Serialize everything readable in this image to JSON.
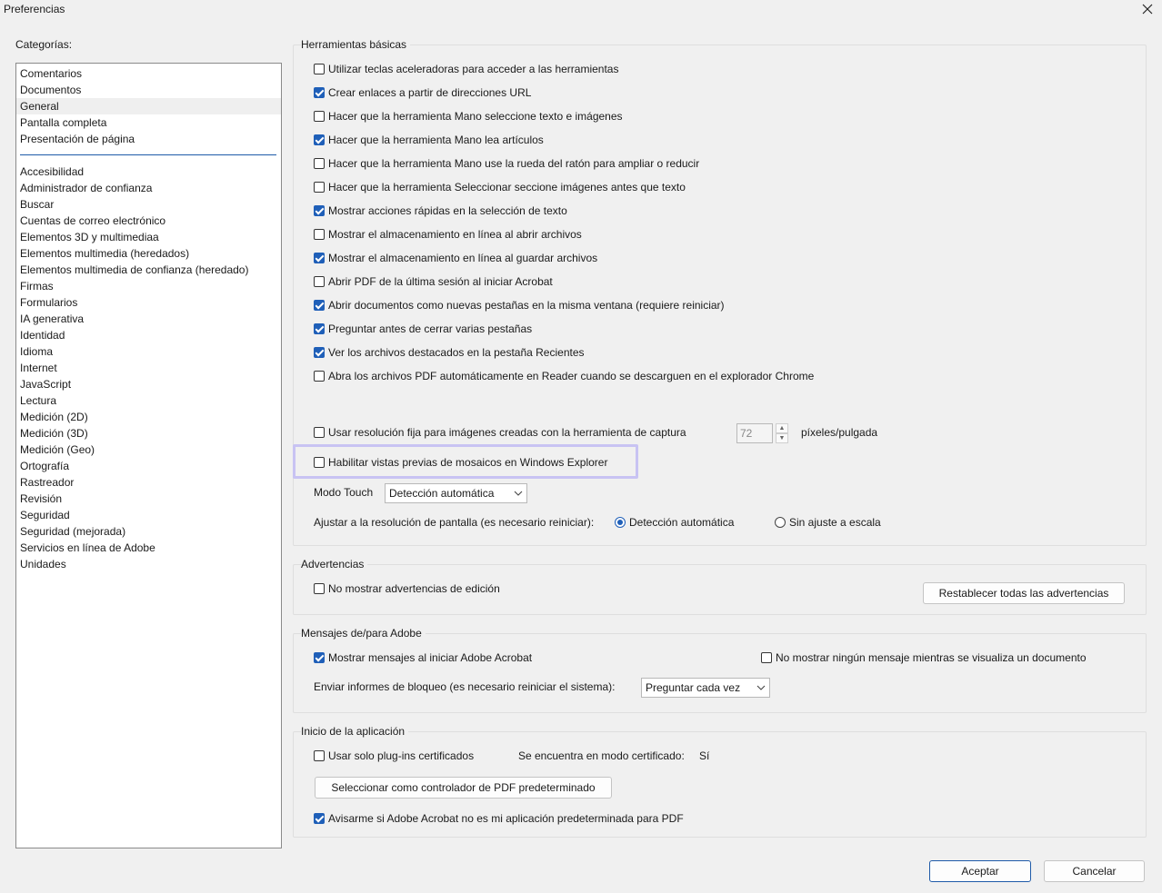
{
  "window": {
    "title": "Preferencias"
  },
  "categories": {
    "label": "Categorías:",
    "top_items": [
      "Comentarios",
      "Documentos",
      "General",
      "Pantalla completa",
      "Presentación de página"
    ],
    "items": [
      "Accesibilidad",
      "Administrador de confianza",
      "Buscar",
      "Cuentas de correo electrónico",
      "Elementos 3D y multimediaa",
      "Elementos multimedia (heredados)",
      "Elementos multimedia de confianza (heredado)",
      "Firmas",
      "Formularios",
      "IA generativa",
      "Identidad",
      "Idioma",
      "Internet",
      "JavaScript",
      "Lectura",
      "Medición (2D)",
      "Medición (3D)",
      "Medición (Geo)",
      "Ortografía",
      "Rastreador",
      "Revisión",
      "Seguridad",
      "Seguridad (mejorada)",
      "Servicios en línea de Adobe",
      "Unidades"
    ],
    "selected": "General"
  },
  "basic_tools": {
    "title": "Herramientas básicas",
    "options": [
      {
        "label": "Utilizar teclas aceleradoras para acceder a las herramientas",
        "checked": false
      },
      {
        "label": "Crear enlaces a partir de direcciones URL",
        "checked": true
      },
      {
        "label": "Hacer que la herramienta Mano seleccione texto e imágenes",
        "checked": false
      },
      {
        "label": "Hacer que la herramienta Mano lea artículos",
        "checked": true
      },
      {
        "label": "Hacer que la herramienta Mano use la rueda del ratón para ampliar o reducir",
        "checked": false
      },
      {
        "label": "Hacer que la herramienta Seleccionar seccione imágenes antes que texto",
        "checked": false
      },
      {
        "label": "Mostrar acciones rápidas en la selección de texto",
        "checked": true
      },
      {
        "label": "Mostrar el almacenamiento en línea al abrir archivos",
        "checked": false
      },
      {
        "label": "Mostrar el almacenamiento en línea al guardar archivos",
        "checked": true
      },
      {
        "label": "Abrir PDF de la última sesión al iniciar Acrobat",
        "checked": false
      },
      {
        "label": "Abrir documentos como nuevas pestañas en la misma ventana (requiere reiniciar)",
        "checked": true
      },
      {
        "label": "Preguntar antes de cerrar varias pestañas",
        "checked": true
      },
      {
        "label": "Ver los archivos destacados en la pestaña Recientes",
        "checked": true
      },
      {
        "label": "Abra los archivos PDF automáticamente en Reader cuando se descarguen en el explorador Chrome",
        "checked": false
      }
    ],
    "fixed_resolution": {
      "label": "Usar resolución fija para imágenes creadas con la herramienta de captura",
      "checked": false,
      "value": "72",
      "unit": "píxeles/pulgada"
    },
    "thumbnails": {
      "label": "Habilitar vistas previas de mosaicos en Windows Explorer",
      "checked": false
    },
    "touch_mode": {
      "label": "Modo Touch",
      "value": "Detección automática"
    },
    "scaling": {
      "label": "Ajustar a la resolución de pantalla (es necesario reiniciar):",
      "option_auto": "Detección automática",
      "option_none": "Sin ajuste a escala",
      "selected": "auto"
    }
  },
  "warnings": {
    "title": "Advertencias",
    "no_edit_warnings": {
      "label": "No mostrar advertencias de edición",
      "checked": false
    },
    "reset_button": "Restablecer todas las advertencias"
  },
  "messages": {
    "title": "Mensajes de/para Adobe",
    "show_on_start": {
      "label": "Mostrar mensajes al iniciar Adobe Acrobat",
      "checked": true
    },
    "no_messages_viewing": {
      "label": "No mostrar ningún mensaje mientras se visualiza un documento",
      "checked": false
    },
    "crash_reports": {
      "label": "Enviar informes de bloqueo (es necesario reiniciar el sistema):",
      "value": "Preguntar cada vez"
    }
  },
  "startup": {
    "title": "Inicio de la aplicación",
    "certified_plugins": {
      "label": "Usar solo plug-ins certificados",
      "checked": false
    },
    "certified_mode_label": "Se encuentra en modo certificado:",
    "certified_mode_value": "Sí",
    "default_handler_button": "Seleccionar como controlador de PDF predeterminado",
    "warn_not_default": {
      "label": "Avisarme si Adobe Acrobat no es mi aplicación predeterminada para PDF",
      "checked": true
    }
  },
  "footer": {
    "ok": "Aceptar",
    "cancel": "Cancelar"
  }
}
